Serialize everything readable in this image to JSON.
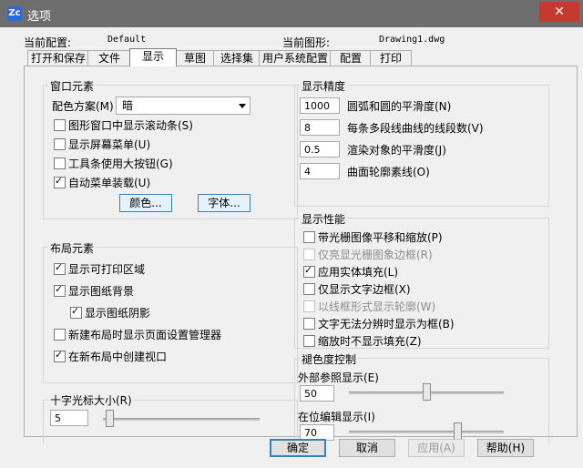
{
  "window": {
    "title": "选项",
    "close_symbol": "✕",
    "app_icon_text": "Zc"
  },
  "header": {
    "current_config_label": "当前配置:",
    "current_config_value": "Default",
    "current_drawing_label": "当前图形:",
    "current_drawing_value": "Drawing1.dwg"
  },
  "tabs": [
    "打开和保存",
    "文件",
    "显示",
    "草图",
    "选择集",
    "用户系统配置",
    "配置",
    "打印"
  ],
  "active_tab": "显示",
  "window_elements": {
    "title": "窗口元素",
    "color_scheme_label": "配色方案(M)",
    "color_scheme_value": "暗",
    "options": [
      {
        "label": "图形窗口中显示滚动条(S)",
        "checked": false
      },
      {
        "label": "显示屏幕菜单(U)",
        "checked": false
      },
      {
        "label": "工具条使用大按钮(G)",
        "checked": false
      },
      {
        "label": "自动菜单装载(U)",
        "checked": true
      }
    ],
    "colors_button": "颜色...",
    "fonts_button": "字体..."
  },
  "layout_elements": {
    "title": "布局元素",
    "options": [
      {
        "label": "显示可打印区域",
        "checked": true
      },
      {
        "label": "显示图纸背景",
        "checked": true
      },
      {
        "label": "显示图纸阴影",
        "checked": true
      },
      {
        "label": "新建布局时显示页面设置管理器",
        "checked": false
      },
      {
        "label": "在新布局中创建视口",
        "checked": true
      }
    ]
  },
  "crosshair": {
    "title": "十字光标大小(R)",
    "value": "5",
    "slider_fraction": 0.04
  },
  "display_resolution": {
    "title": "显示精度",
    "rows": [
      {
        "value": "1000",
        "label": "圆弧和圆的平滑度(N)"
      },
      {
        "value": "8",
        "label": "每条多段线曲线的线段数(V)"
      },
      {
        "value": "0.5",
        "label": "渲染对象的平滑度(J)"
      },
      {
        "value": "4",
        "label": "曲面轮廓素线(O)"
      }
    ]
  },
  "display_performance": {
    "title": "显示性能",
    "options": [
      {
        "label": "带光栅图像平移和缩放(P)",
        "checked": false,
        "disabled": false
      },
      {
        "label": "仅亮显光栅图象边框(R)",
        "checked": false,
        "disabled": true
      },
      {
        "label": "应用实体填充(L)",
        "checked": true,
        "disabled": false
      },
      {
        "label": "仅显示文字边框(X)",
        "checked": false,
        "disabled": false
      },
      {
        "label": "以线框形式显示轮廓(W)",
        "checked": false,
        "disabled": true
      },
      {
        "label": "文字无法分辨时显示为框(B)",
        "checked": false,
        "disabled": false
      },
      {
        "label": "缩放时不显示填充(Z)",
        "checked": false,
        "disabled": false
      }
    ]
  },
  "fade_control": {
    "title": "褪色度控制",
    "xref_label": "外部参照显示(E)",
    "xref_value": "50",
    "xref_fraction": 0.5,
    "inplace_label": "在位编辑显示(I)",
    "inplace_value": "70",
    "inplace_fraction": 0.7
  },
  "footer": {
    "ok": "确定",
    "cancel": "取消",
    "apply": "应用(A)",
    "help": "帮助(H)"
  }
}
